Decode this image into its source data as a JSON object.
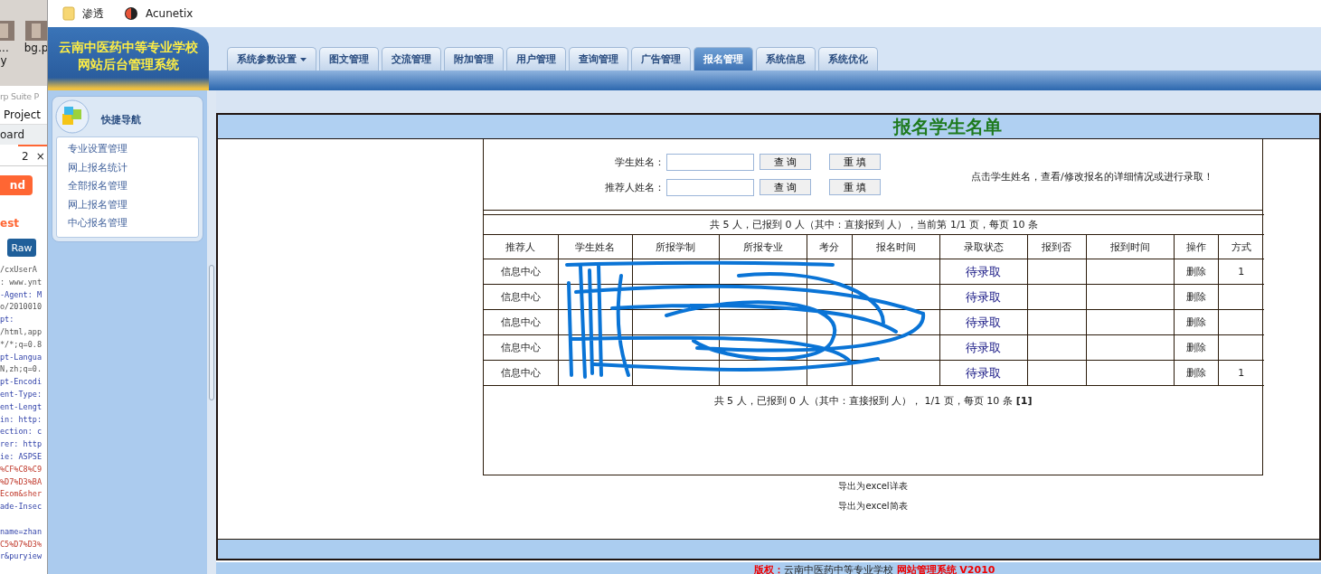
{
  "background_window": {
    "desktop_icons": [
      {
        "lines": [
          "...",
          "y"
        ]
      },
      {
        "lines": [
          "bg.p"
        ]
      }
    ],
    "title": "rp Suite P",
    "menu": [
      "Project"
    ],
    "tab_label": "oard",
    "request_tab": {
      "label": "2",
      "close": "×"
    },
    "send_button": "nd",
    "section_title": "est",
    "view_tabs": [
      {
        "label": "Raw",
        "selected": true
      }
    ],
    "request_lines": [
      {
        "text": "/cxUserA",
        "kind": "value"
      },
      {
        "text": ": www.ynt",
        "kind": "value"
      },
      {
        "text": "-Agent: M",
        "kind": "name"
      },
      {
        "text": "o/2010010",
        "kind": "value"
      },
      {
        "text": "pt:",
        "kind": "name"
      },
      {
        "text": "/html,app",
        "kind": "value"
      },
      {
        "text": "*/*;q=0.8",
        "kind": "value"
      },
      {
        "text": "pt-Langua",
        "kind": "name"
      },
      {
        "text": "N,zh;q=0.",
        "kind": "value"
      },
      {
        "text": "pt-Encodi",
        "kind": "name"
      },
      {
        "text": "ent-Type:",
        "kind": "name"
      },
      {
        "text": "ent-Lengt",
        "kind": "name"
      },
      {
        "text": "in: http:",
        "kind": "name"
      },
      {
        "text": "ection: c",
        "kind": "name"
      },
      {
        "text": "rer: http",
        "kind": "name"
      },
      {
        "text": "ie: ASPSE",
        "kind": "name"
      },
      {
        "text": "%CF%C8%C9",
        "kind": "cookie"
      },
      {
        "text": "%D7%D3%BA",
        "kind": "cookie"
      },
      {
        "text": "Ecom&sher",
        "kind": "cookie"
      },
      {
        "text": "ade-Insec",
        "kind": "name"
      },
      {
        "kind": "blank"
      },
      {
        "text": "name=zhan",
        "kind": "name"
      },
      {
        "text": "C5%D7%D3%",
        "kind": "cookie"
      },
      {
        "text": "r&puryiew",
        "kind": "name"
      }
    ]
  },
  "bookmarks": [
    {
      "label": "渗透",
      "kind": "folder"
    },
    {
      "label": "Acunetix",
      "kind": "app"
    }
  ],
  "site_title": [
    "云南中医药中等专业学校",
    "网站后台管理系统"
  ],
  "nav_tabs": [
    {
      "label": "系统参数设置",
      "selected": false,
      "dropdown": true
    },
    {
      "label": "图文管理",
      "selected": false,
      "dropdown": false
    },
    {
      "label": "交流管理",
      "selected": false,
      "dropdown": false
    },
    {
      "label": "附加管理",
      "selected": false,
      "dropdown": false
    },
    {
      "label": "用户管理",
      "selected": false,
      "dropdown": false
    },
    {
      "label": "查询管理",
      "selected": false,
      "dropdown": false
    },
    {
      "label": "广告管理",
      "selected": false,
      "dropdown": false
    },
    {
      "label": "报名管理",
      "selected": true,
      "dropdown": false
    },
    {
      "label": "系统信息",
      "selected": false,
      "dropdown": false
    },
    {
      "label": "系统优化",
      "selected": false,
      "dropdown": false
    }
  ],
  "sidebar": {
    "title": "快捷导航",
    "items": [
      "专业设置管理",
      "网上报名统计",
      "全部报名管理",
      "网上报名管理",
      "中心报名管理"
    ]
  },
  "page": {
    "heading": "报名学生名单",
    "search_rows": [
      {
        "label": "学生姓名：",
        "query_button": "查 询",
        "reset_button": "重 填"
      },
      {
        "label": "推荐人姓名：",
        "query_button": "查 询",
        "reset_button": "重 填"
      }
    ],
    "hint": "点击学生姓名，查看/修改报名的详细情况或进行录取！",
    "table": {
      "summary": "共 5 人，已报到 0 人（其中：直接报到 人），当前第 1/1 页，每页 10 条",
      "columns": [
        "推荐人",
        "学生姓名",
        "所报学制",
        "所报专业",
        "考分",
        "报名时间",
        "录取状态",
        "报到否",
        "报到时间",
        "操作",
        "方式"
      ],
      "rows": [
        {
          "referrer": "信息中心",
          "status": "待录取",
          "action": "删除",
          "mode": "1"
        },
        {
          "referrer": "信息中心",
          "status": "待录取",
          "action": "删除"
        },
        {
          "referrer": "信息中心",
          "status": "待录取",
          "action": "删除"
        },
        {
          "referrer": "信息中心",
          "status": "待录取",
          "action": "删除"
        },
        {
          "referrer": "信息中心",
          "status": "待录取",
          "action": "删除",
          "mode": "1"
        }
      ]
    },
    "pager": {
      "text": "共 5 人，已报到 0 人（其中：直接报到 人）， 1/1 页，每页 10 条",
      "pages": [
        "[1]"
      ]
    },
    "export_links": [
      "导出为excel详表",
      "导出为excel简表"
    ]
  },
  "footer": {
    "label": "版权：",
    "school": "云南中医药中等专业学校",
    "system": "网站管理系统 V2010"
  }
}
